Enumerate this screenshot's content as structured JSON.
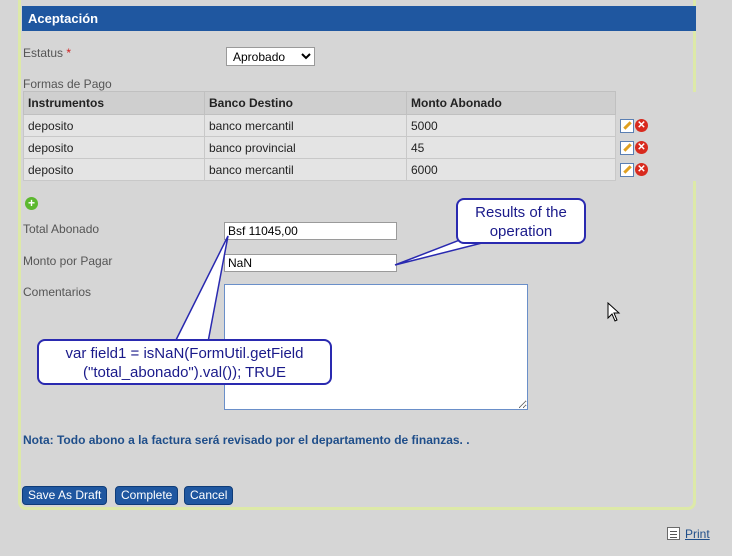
{
  "header": {
    "title": "Aceptación"
  },
  "status": {
    "label": "Estatus",
    "required_mark": "*",
    "selected": "Aprobado"
  },
  "payment_forms": {
    "label": "Formas de Pago",
    "columns": [
      "Instrumentos",
      "Banco Destino",
      "Monto Abonado"
    ],
    "rows": [
      [
        "deposito",
        "banco mercantil",
        "5000"
      ],
      [
        "deposito",
        "banco provincial",
        "45"
      ],
      [
        "deposito",
        "banco mercantil",
        "6000"
      ]
    ]
  },
  "total_abonado": {
    "label": "Total Abonado",
    "value": "Bsf 11045,00"
  },
  "monto_por_pagar": {
    "label": "Monto por Pagar",
    "value": "NaN"
  },
  "comentarios": {
    "label": "Comentarios",
    "value": ""
  },
  "note": "Nota: Todo abono a la factura será revisado por el departamento de finanzas. .",
  "buttons": {
    "save_draft": "Save As Draft",
    "complete": "Complete",
    "cancel": "Cancel"
  },
  "callouts": {
    "results": "Results of the operation",
    "code": "var field1 = isNaN(FormUtil.getField (\"total_abonado\").val()); TRUE"
  },
  "print": {
    "label": "Print"
  },
  "icons": {
    "edit": "edit-icon",
    "delete": "delete-icon",
    "add": "add-icon",
    "print": "print-icon"
  },
  "colors": {
    "header": "#1f57a0",
    "button": "#1f57a0",
    "note": "#1f4e8a",
    "callout_border": "#2a2ab0"
  }
}
